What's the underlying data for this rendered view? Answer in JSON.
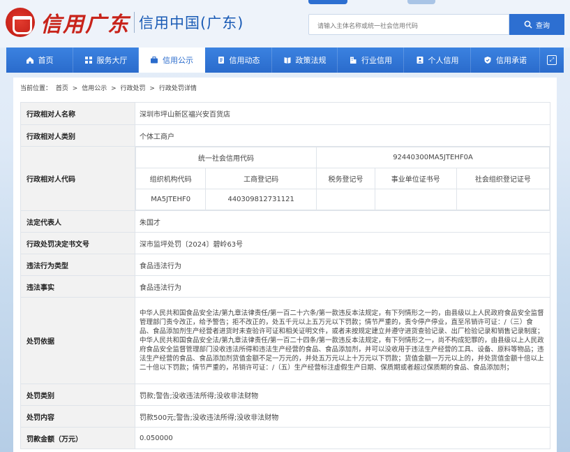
{
  "logo": {
    "script_text": "信用广东",
    "title": "信用中国(广东)"
  },
  "search": {
    "placeholder": "请输入主体名称或统一社会信用代码",
    "button_label": "查询"
  },
  "nav": {
    "items": [
      {
        "label": "首页",
        "icon": "home-icon"
      },
      {
        "label": "服务大厅",
        "icon": "grid-icon"
      },
      {
        "label": "信用公示",
        "icon": "briefcase-icon",
        "active": true
      },
      {
        "label": "信用动态",
        "icon": "document-icon"
      },
      {
        "label": "政策法规",
        "icon": "book-icon"
      },
      {
        "label": "行业信用",
        "icon": "building-icon"
      },
      {
        "label": "个人信用",
        "icon": "person-icon"
      },
      {
        "label": "信用承诺",
        "icon": "shield-icon"
      }
    ]
  },
  "breadcrumb": {
    "prefix": "当前位置：",
    "items": [
      "首页",
      "信用公示",
      "行政处罚",
      "行政处罚详情"
    ],
    "separator": ">"
  },
  "detail": {
    "subject_name": {
      "label": "行政相对人名称",
      "value": "深圳市坪山新区福兴安百货店"
    },
    "subject_type": {
      "label": "行政相对人类别",
      "value": "个体工商户"
    },
    "subject_code": {
      "label": "行政相对人代码",
      "uscc_label": "统一社会信用代码",
      "uscc_value": "92440300MA5JTEHF0A",
      "headers": [
        "组织机构代码",
        "工商登记码",
        "税务登记号",
        "事业单位证书号",
        "社会组织登记证号"
      ],
      "values": [
        "MA5JTEHF0",
        "440309812731121",
        "",
        "",
        ""
      ]
    },
    "legal_rep": {
      "label": "法定代表人",
      "value": "朱国才"
    },
    "decision_no": {
      "label": "行政处罚决定书文号",
      "value": "深市监坪处罚〔2024〕碧岭63号"
    },
    "violation_type": {
      "label": "违法行为类型",
      "value": "食品违法行为"
    },
    "violation_facts": {
      "label": "违法事实",
      "value": "食品违法行为"
    },
    "basis": {
      "label": "处罚依据",
      "value": "中华人民共和国食品安全法/第九章法律责任/第一百二十六条/第一款违反本法规定，有下列情形之一的，由县级以上人民政府食品安全监督管理部门责令改正，给予警告；拒不改正的，处五千元以上五万元以下罚款；情节严重的，责令停产停业，直至吊销许可证：/（三）食品、食品添加剂生产经营者进货时未查验许可证和相关证明文件，或者未按规定建立并遵守进货查验记录、出厂检验记录和销售记录制度；中华人民共和国食品安全法/第九章法律责任/第一百二十四条/第一款违反本法规定，有下列情形之一，尚不构成犯罪的，由县级以上人民政府食品安全监督管理部门没收违法所得和违法生产经营的食品、食品添加剂，并可以没收用于违法生产经营的工具、设备、原料等物品；违法生产经营的食品、食品添加剂货值金额不足一万元的，并处五万元以上十万元以下罚款；货值金额一万元以上的，并处货值金额十倍以上二十倍以下罚款；情节严重的，吊销许可证：/（五）生产经营标注虚假生产日期、保质期或者超过保质期的食品、食品添加剂；"
    },
    "penalty_category": {
      "label": "处罚类别",
      "value": "罚款;警告;没收违法所得;没收非法财物"
    },
    "penalty_content": {
      "label": "处罚内容",
      "value": "罚款500元;警告;没收违法所得;没收非法财物"
    },
    "fine_amount": {
      "label": "罚款金额（万元）",
      "value": "0.050000"
    }
  }
}
